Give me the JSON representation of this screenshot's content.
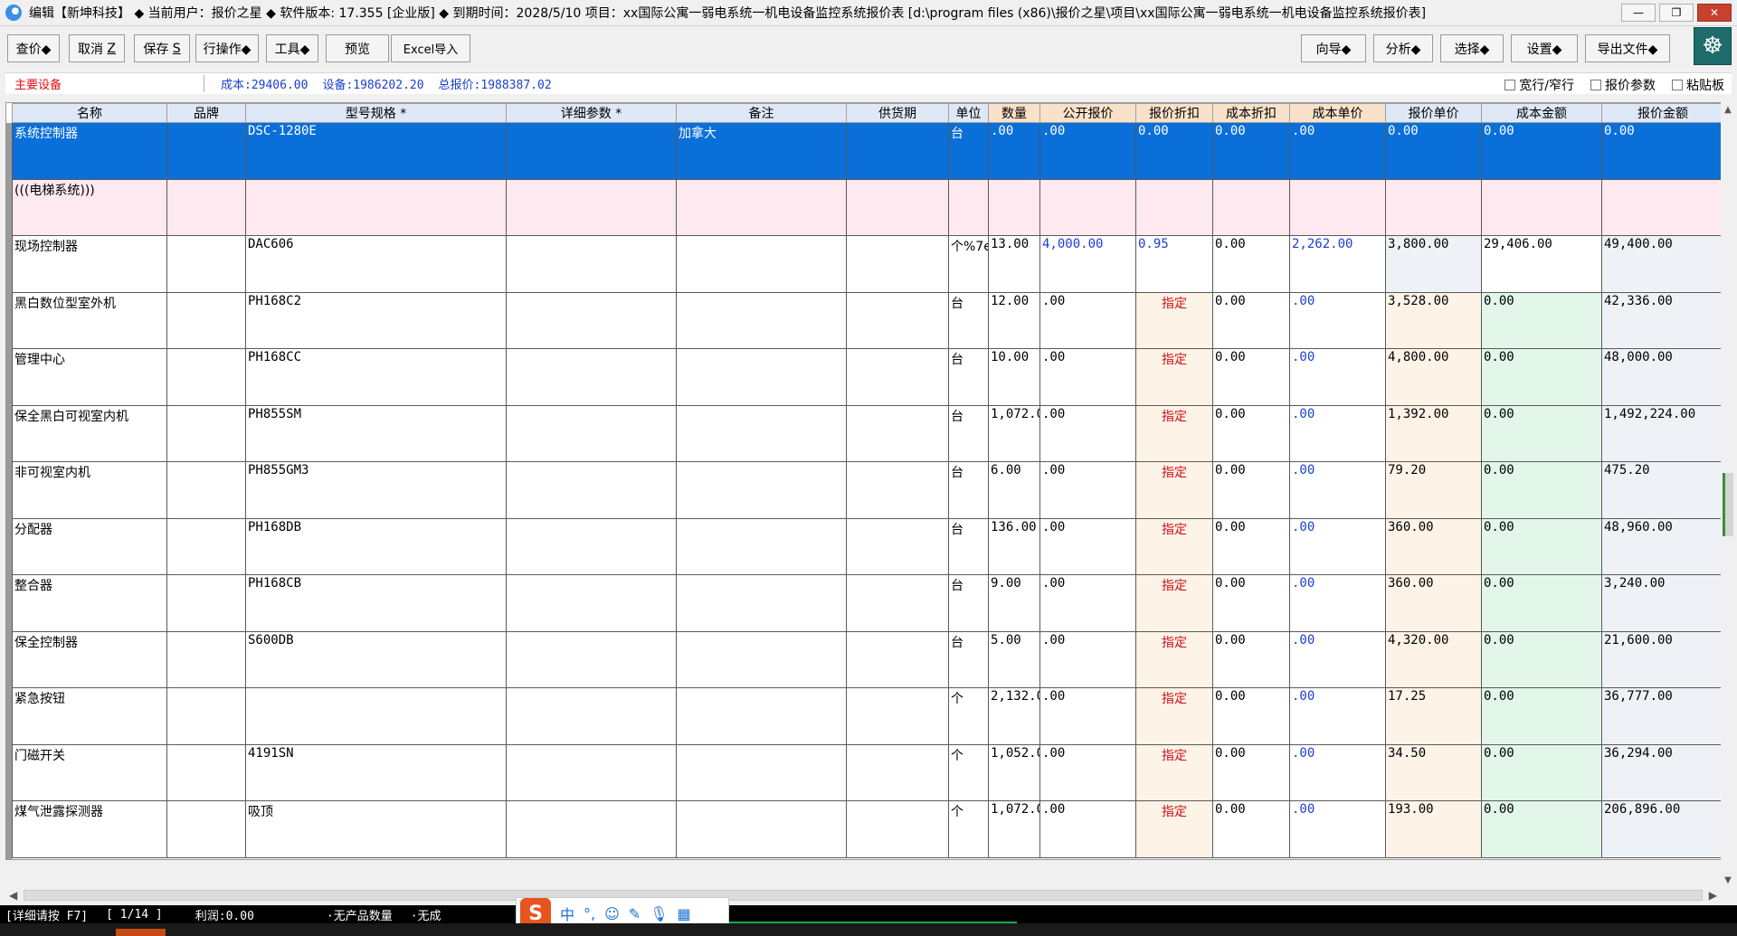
{
  "title": "编辑【新坤科技】  ◆ 当前用户：报价之星  ◆ 软件版本: 17.355  [企业版]  ◆ 到期时间：2028/5/10 项目：xx国际公寓一弱电系统一机电设备监控系统报价表    [d:\\program files (x86)\\报价之星\\项目\\xx国际公寓一弱电系统一机电设备监控系统报价表]",
  "window_buttons": {
    "minimize": "—",
    "restore": "❐",
    "close": "✕"
  },
  "toolbar": {
    "query": "查价◆",
    "cancel": "取消",
    "cancel_key": "Z",
    "save": "保存",
    "save_key": "S",
    "row_ops": "行操作◆",
    "tools": "工具◆",
    "preview": "预览",
    "excel_import": "Excel导入",
    "wizard": "向导◆",
    "analyze": "分析◆",
    "select": "选择◆",
    "settings": "设置◆",
    "export": "导出文件◆"
  },
  "info": {
    "section": "主要设备",
    "cost": "成本:29406.00",
    "equipment": "设备:1986202.20",
    "total": "总报价:1988387.02",
    "opt_row_width": "宽行/窄行",
    "opt_params": "报价参数",
    "opt_paste": "粘贴板"
  },
  "columns": [
    "名称",
    "品牌",
    "型号规格 *",
    "详细参数 *",
    "备注",
    "供货期",
    "单位",
    "数量",
    "公开报价",
    "报价折扣",
    "成本折扣",
    "成本单价",
    "报价单价",
    "成本金额",
    "报价金额"
  ],
  "rows": [
    {
      "name": "系统控制器",
      "brand": "",
      "model": "DSC-1280E",
      "params": "",
      "note": "加拿大",
      "supply": "",
      "unit": "台",
      "qty": ".00",
      "list": ".00",
      "disc": "0.00",
      "cdisc": "0.00",
      "cunit": ".00",
      "qunit": "0.00",
      "camt": "0.00",
      "qamt": "0.00",
      "type": "selected"
    },
    {
      "name": "(((电梯系统)))",
      "brand": "",
      "model": "",
      "params": "",
      "note": "",
      "supply": "",
      "unit": "",
      "qty": "",
      "list": "",
      "disc": "",
      "cdisc": "",
      "cunit": "",
      "qunit": "",
      "camt": "",
      "qamt": "",
      "type": "group"
    },
    {
      "name": "现场控制器",
      "brand": "",
      "model": "DAC606",
      "params": "",
      "note": "",
      "supply": "",
      "unit": "个%7e",
      "qty": "13.00",
      "list": "4,000.00",
      "disc": "0.95",
      "cdisc": "0.00",
      "cunit": "2,262.00",
      "qunit": "3,800.00",
      "camt": "29,406.00",
      "qamt": "49,400.00",
      "type": "normal"
    },
    {
      "name": "黑白数位型室外机",
      "brand": "",
      "model": "PH168C2",
      "params": "",
      "note": "",
      "supply": "",
      "unit": "台",
      "qty": "12.00",
      "list": ".00",
      "disc": "指定",
      "cdisc": "0.00",
      "cunit": ".00",
      "qunit": "3,528.00",
      "camt": "0.00",
      "qamt": "42,336.00",
      "type": "normal"
    },
    {
      "name": "管理中心",
      "brand": "",
      "model": "PH168CC",
      "params": "",
      "note": "",
      "supply": "",
      "unit": "台",
      "qty": "10.00",
      "list": ".00",
      "disc": "指定",
      "cdisc": "0.00",
      "cunit": ".00",
      "qunit": "4,800.00",
      "camt": "0.00",
      "qamt": "48,000.00",
      "type": "normal"
    },
    {
      "name": "保全黑白可视室内机",
      "brand": "",
      "model": "PH855SM",
      "params": "",
      "note": "",
      "supply": "",
      "unit": "台",
      "qty": "1,072.0",
      "list": ".00",
      "disc": "指定",
      "cdisc": "0.00",
      "cunit": ".00",
      "qunit": "1,392.00",
      "camt": "0.00",
      "qamt": "1,492,224.00",
      "type": "normal"
    },
    {
      "name": "非可视室内机",
      "brand": "",
      "model": "PH855GM3",
      "params": "",
      "note": "",
      "supply": "",
      "unit": "台",
      "qty": "6.00",
      "list": ".00",
      "disc": "指定",
      "cdisc": "0.00",
      "cunit": ".00",
      "qunit": "79.20",
      "camt": "0.00",
      "qamt": "475.20",
      "type": "normal"
    },
    {
      "name": "分配器",
      "brand": "",
      "model": "PH168DB",
      "params": "",
      "note": "",
      "supply": "",
      "unit": "台",
      "qty": "136.00",
      "list": ".00",
      "disc": "指定",
      "cdisc": "0.00",
      "cunit": ".00",
      "qunit": "360.00",
      "camt": "0.00",
      "qamt": "48,960.00",
      "type": "normal"
    },
    {
      "name": "整合器",
      "brand": "",
      "model": "PH168CB",
      "params": "",
      "note": "",
      "supply": "",
      "unit": "台",
      "qty": "9.00",
      "list": ".00",
      "disc": "指定",
      "cdisc": "0.00",
      "cunit": ".00",
      "qunit": "360.00",
      "camt": "0.00",
      "qamt": "3,240.00",
      "type": "normal"
    },
    {
      "name": "保全控制器",
      "brand": "",
      "model": "S600DB",
      "params": "",
      "note": "",
      "supply": "",
      "unit": "台",
      "qty": "5.00",
      "list": ".00",
      "disc": "指定",
      "cdisc": "0.00",
      "cunit": ".00",
      "qunit": "4,320.00",
      "camt": "0.00",
      "qamt": "21,600.00",
      "type": "normal"
    },
    {
      "name": "紧急按钮",
      "brand": "",
      "model": "",
      "params": "",
      "note": "",
      "supply": "",
      "unit": "个",
      "qty": "2,132.0",
      "list": ".00",
      "disc": "指定",
      "cdisc": "0.00",
      "cunit": ".00",
      "qunit": "17.25",
      "camt": "0.00",
      "qamt": "36,777.00",
      "type": "normal"
    },
    {
      "name": "门磁开关",
      "brand": "",
      "model": "4191SN",
      "params": "",
      "note": "",
      "supply": "",
      "unit": "个",
      "qty": "1,052.0",
      "list": ".00",
      "disc": "指定",
      "cdisc": "0.00",
      "cunit": ".00",
      "qunit": "34.50",
      "camt": "0.00",
      "qamt": "36,294.00",
      "type": "normal"
    },
    {
      "name": "煤气泄露探测器",
      "brand": "",
      "model": "吸顶",
      "params": "",
      "note": "",
      "supply": "",
      "unit": "个",
      "qty": "1,072.0",
      "list": ".00",
      "disc": "指定",
      "cdisc": "0.00",
      "cunit": ".00",
      "qunit": "193.00",
      "camt": "0.00",
      "qamt": "206,896.00",
      "type": "normal"
    }
  ],
  "status": {
    "detail_hint": "[详细请按 F7]",
    "page": "[ 1/14 ]",
    "profit": "利润:0.00",
    "no_qty": "·无产品数量",
    "no_cost": "·无成"
  },
  "ime": {
    "lang": "中",
    "punct": "°,"
  }
}
